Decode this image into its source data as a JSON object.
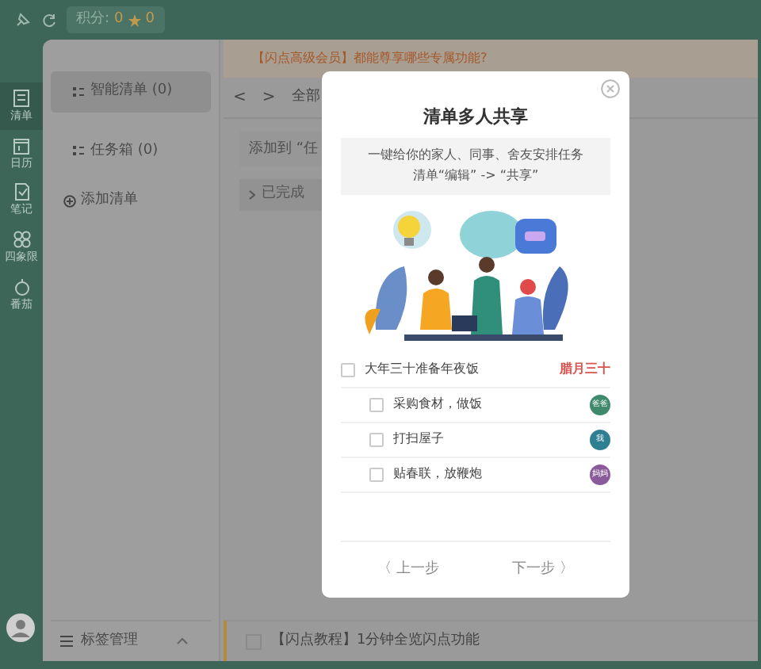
{
  "top_bar": {
    "points_label": "积分:",
    "points_value": "0",
    "level_value": "0"
  },
  "nav": [
    {
      "label": "清单",
      "selected": true
    },
    {
      "label": "日历",
      "selected": false
    },
    {
      "label": "笔记",
      "selected": false
    },
    {
      "label": "四象限",
      "selected": false
    },
    {
      "label": "番茄",
      "selected": false
    }
  ],
  "lists": [
    {
      "label": "智能清单 (0)",
      "selected": true
    },
    {
      "label": "任务箱 (0)",
      "selected": false
    }
  ],
  "add_list": "添加清单",
  "tag_manage": "标签管理",
  "banner": "【闪点高级会员】都能尊享哪些专属功能?",
  "toolbar": {
    "prev": "<",
    "next": ">",
    "filter": "全部"
  },
  "add_field": {
    "placeholder": "添加到 “任"
  },
  "completed": "已完成",
  "bottom_task": {
    "title": "【闪点教程】1分钟全览闪点功能",
    "checked": false
  },
  "dialog": {
    "title": "清单多人共享",
    "description": [
      "一键给你的家人、同事、舍友安排任务",
      "清单“编辑” -> “共享”"
    ],
    "tasks": [
      {
        "title": "大年三十准备年夜饭",
        "date": "腊月三十",
        "checked": false,
        "children": [
          {
            "title": "采购食材，做饭",
            "assignee": "爸爸",
            "color": "#3f8a6c",
            "checked": false
          },
          {
            "title": "打扫屋子",
            "assignee": "我",
            "color": "#2f7f93",
            "checked": false
          },
          {
            "title": "贴春联，放鞭炮",
            "assignee": "妈妈",
            "color": "#8a5a9a",
            "checked": false
          }
        ]
      }
    ],
    "prev": "〈 上一步",
    "next": "下一步 〉"
  }
}
